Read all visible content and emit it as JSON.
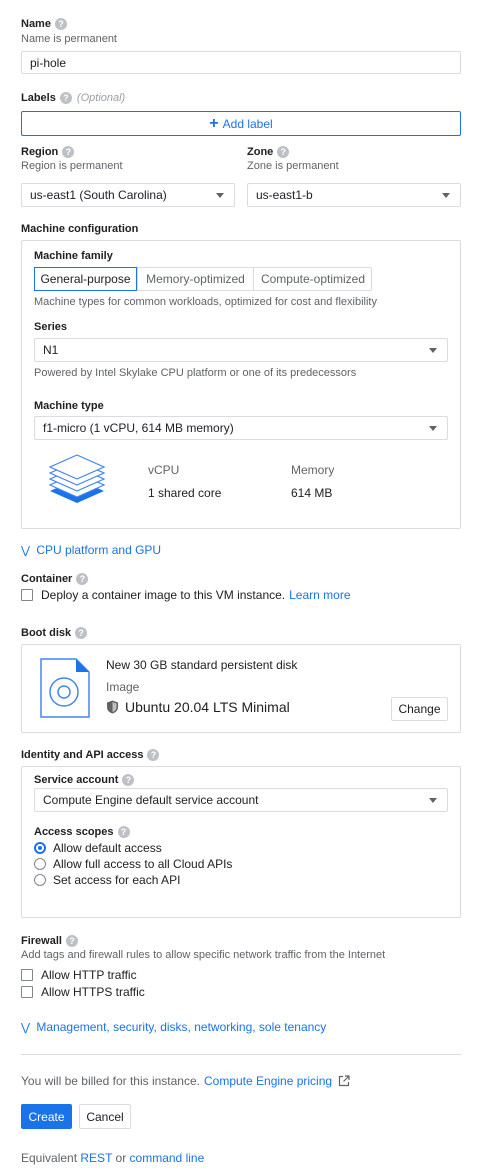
{
  "name": {
    "label": "Name",
    "sub": "Name is permanent",
    "value": "pi-hole"
  },
  "labels": {
    "label": "Labels",
    "optional": "(Optional)",
    "add_button": "Add label"
  },
  "region": {
    "label": "Region",
    "sub": "Region is permanent",
    "value": "us-east1 (South Carolina)"
  },
  "zone": {
    "label": "Zone",
    "sub": "Zone is permanent",
    "value": "us-east1-b"
  },
  "machine_config": {
    "heading": "Machine configuration",
    "family_label": "Machine family",
    "tabs": [
      {
        "label": "General-purpose",
        "active": true
      },
      {
        "label": "Memory-optimized",
        "active": false
      },
      {
        "label": "Compute-optimized",
        "active": false
      }
    ],
    "family_desc": "Machine types for common workloads, optimized for cost and flexibility",
    "series_label": "Series",
    "series_value": "N1",
    "series_desc": "Powered by Intel Skylake CPU platform or one of its predecessors",
    "type_label": "Machine type",
    "type_value": "f1-micro (1 vCPU, 614 MB memory)",
    "vcpu_header": "vCPU",
    "vcpu_value": "1 shared core",
    "memory_header": "Memory",
    "memory_value": "614 MB"
  },
  "cpu_platform_link": "CPU platform and GPU",
  "container": {
    "label": "Container",
    "checkbox_label": "Deploy a container image to this VM instance.",
    "learn_more": "Learn more",
    "checked": false
  },
  "boot_disk": {
    "label": "Boot disk",
    "title": "New 30 GB standard persistent disk",
    "image_label": "Image",
    "image_value": "Ubuntu 20.04 LTS Minimal",
    "change_button": "Change"
  },
  "identity": {
    "heading": "Identity and API access",
    "service_account_label": "Service account",
    "service_account_value": "Compute Engine default service account",
    "access_scopes_label": "Access scopes",
    "scopes": [
      {
        "label": "Allow default access",
        "selected": true
      },
      {
        "label": "Allow full access to all Cloud APIs",
        "selected": false
      },
      {
        "label": "Set access for each API",
        "selected": false
      }
    ]
  },
  "firewall": {
    "label": "Firewall",
    "desc": "Add tags and firewall rules to allow specific network traffic from the Internet",
    "http": "Allow HTTP traffic",
    "https": "Allow HTTPS traffic"
  },
  "management_link": "Management, security, disks, networking, sole tenancy",
  "billing": {
    "text": "You will be billed for this instance.",
    "link": "Compute Engine pricing"
  },
  "actions": {
    "create": "Create",
    "cancel": "Cancel"
  },
  "footer": {
    "prefix": "Equivalent",
    "rest": "REST",
    "or": "or",
    "cli": "command line"
  },
  "colors": {
    "accent": "#1a73e8",
    "border": "#dadce0",
    "text": "#202124",
    "muted": "#5f6368"
  }
}
